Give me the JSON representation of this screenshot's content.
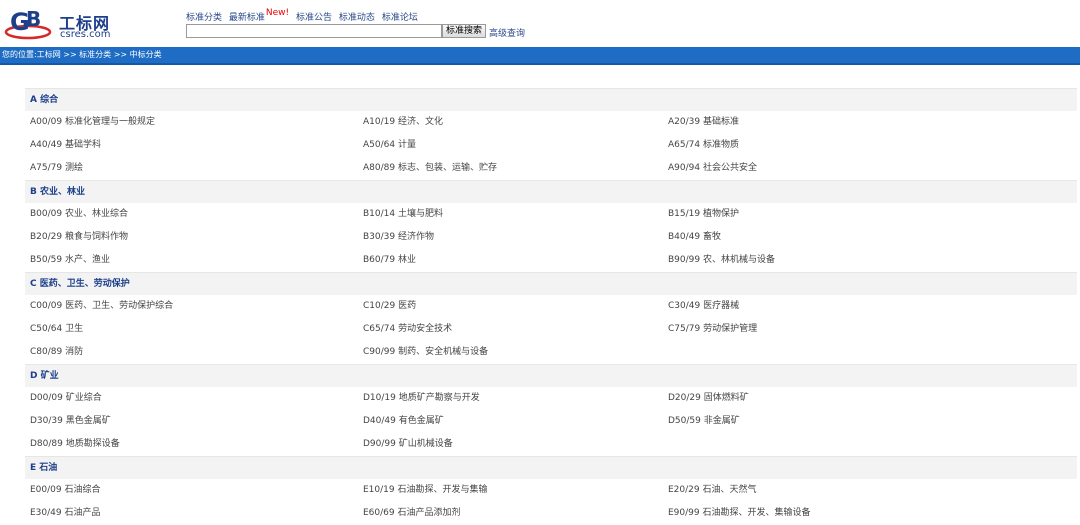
{
  "logo": {
    "title": "工标网",
    "subtitle": "csres.com"
  },
  "nav": {
    "links": [
      "标准分类",
      "最新标准",
      "标准公告",
      "标准动态",
      "标准论坛"
    ],
    "new_badge": "New!"
  },
  "search": {
    "value": "",
    "button_label": "标准搜索",
    "advanced_label": "高级查询"
  },
  "breadcrumb": {
    "text": "您的位置:工标网 >> 标准分类 >> 中标分类"
  },
  "categories": [
    {
      "title": "A 综合",
      "items": [
        "A00/09 标准化管理与一般规定",
        "A10/19 经济、文化",
        "A20/39 基础标准",
        "A40/49 基础学科",
        "A50/64 计量",
        "A65/74 标准物质",
        "A75/79 测绘",
        "A80/89 标志、包装、运输、贮存",
        "A90/94 社会公共安全"
      ]
    },
    {
      "title": "B 农业、林业",
      "items": [
        "B00/09 农业、林业综合",
        "B10/14 土壤与肥料",
        "B15/19 植物保护",
        "B20/29 粮食与饲料作物",
        "B30/39 经济作物",
        "B40/49 畜牧",
        "B50/59 水产、渔业",
        "B60/79 林业",
        "B90/99 农、林机械与设备"
      ]
    },
    {
      "title": "C 医药、卫生、劳动保护",
      "items": [
        "C00/09 医药、卫生、劳动保护综合",
        "C10/29 医药",
        "C30/49 医疗器械",
        "C50/64 卫生",
        "C65/74 劳动安全技术",
        "C75/79 劳动保护管理",
        "C80/89 消防",
        "C90/99 制药、安全机械与设备"
      ]
    },
    {
      "title": "D 矿业",
      "items": [
        "D00/09 矿业综合",
        "D10/19 地质矿产勘察与开发",
        "D20/29 固体燃料矿",
        "D30/39 黑色金属矿",
        "D40/49 有色金属矿",
        "D50/59 非金属矿",
        "D80/89 地质勘探设备",
        "D90/99 矿山机械设备"
      ]
    },
    {
      "title": "E 石油",
      "items": [
        "E00/09 石油综合",
        "E10/19 石油勘探、开发与集输",
        "E20/29 石油、天然气",
        "E30/49 石油产品",
        "E60/69 石油产品添加剂",
        "E90/99 石油勘探、开发、集输设备"
      ]
    }
  ]
}
